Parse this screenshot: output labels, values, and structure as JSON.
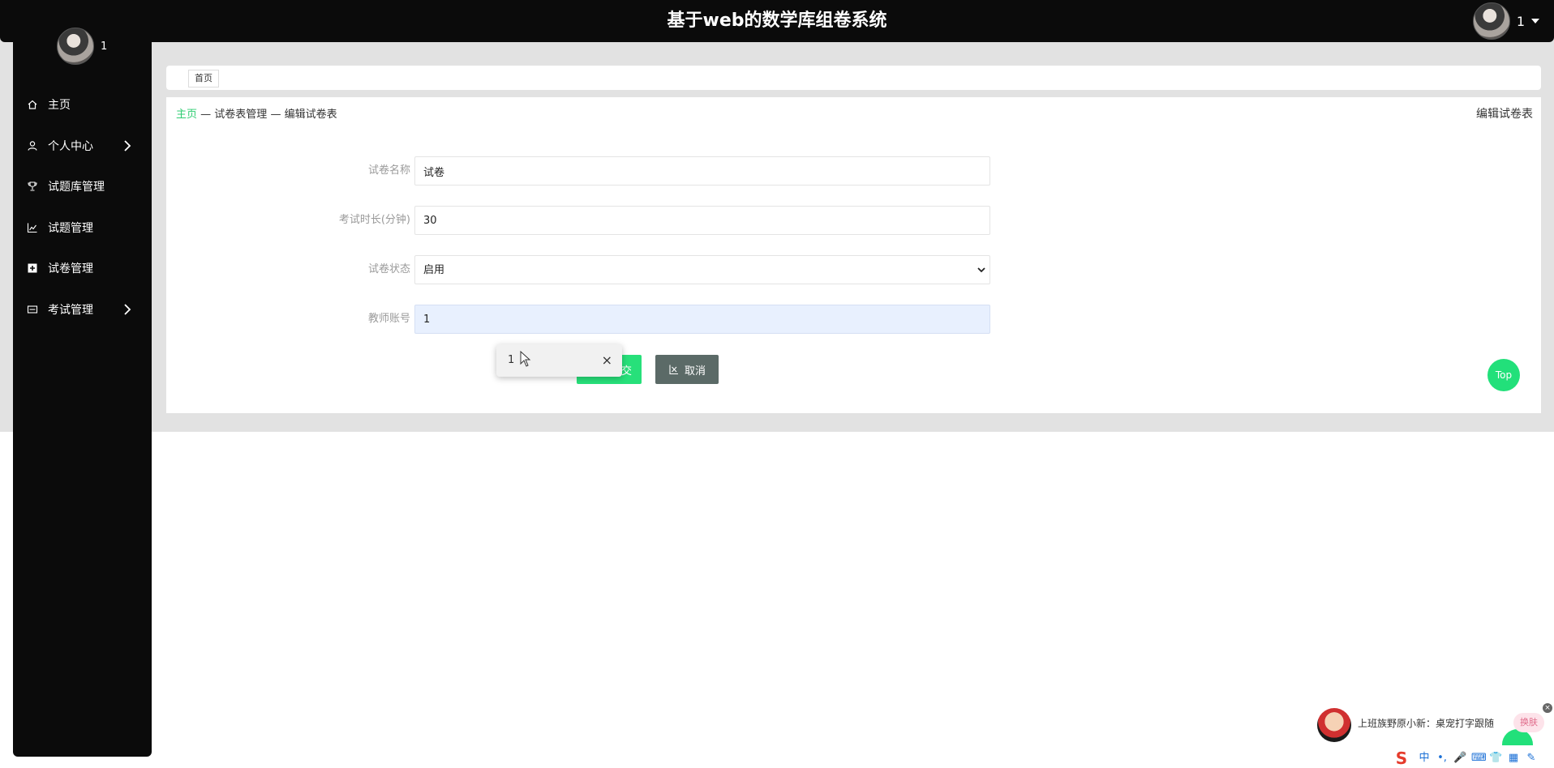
{
  "header": {
    "title": "基于web的数学库组卷系统",
    "user_name": "1"
  },
  "sidebar": {
    "user_name": "1",
    "items": [
      {
        "label": "主页",
        "icon": "home-icon"
      },
      {
        "label": "个人中心",
        "icon": "user-icon",
        "has_submenu": true
      },
      {
        "label": "试题库管理",
        "icon": "trophy-icon"
      },
      {
        "label": "试题管理",
        "icon": "line-chart-icon"
      },
      {
        "label": "试卷管理",
        "icon": "plus-square-icon"
      },
      {
        "label": "考试管理",
        "icon": "card-icon",
        "has_submenu": true
      }
    ]
  },
  "tabs": [
    {
      "label": "首页"
    }
  ],
  "breadcrumb": {
    "home": "主页",
    "separator": "—",
    "level1": "试卷表管理",
    "level2": "编辑试卷表"
  },
  "page_heading": "编辑试卷表",
  "form": {
    "fields": [
      {
        "label": "试卷名称",
        "value": "试卷"
      },
      {
        "label": "考试时长(分钟)",
        "value": "30"
      },
      {
        "label": "试卷状态",
        "value": "启用",
        "options": [
          "启用"
        ]
      },
      {
        "label": "教师账号",
        "value": "1"
      }
    ],
    "submit_label": "交",
    "cancel_label": "取消"
  },
  "autocomplete": {
    "value": "1",
    "close": "×"
  },
  "top_button": "Top",
  "ime": {
    "text": "上班族野原小新：桌宠打字跟随",
    "skin_label": "换肤",
    "close": "×",
    "logo": "S",
    "tools": [
      "中",
      "•,",
      "🎤",
      "⌨",
      "👕",
      "▦",
      "✎"
    ]
  },
  "colors": {
    "accent": "#27e07a",
    "cancel": "#5b6a67",
    "sidebar_bg": "#0b0b0b",
    "breadcrumb_home": "#2ecc71"
  }
}
